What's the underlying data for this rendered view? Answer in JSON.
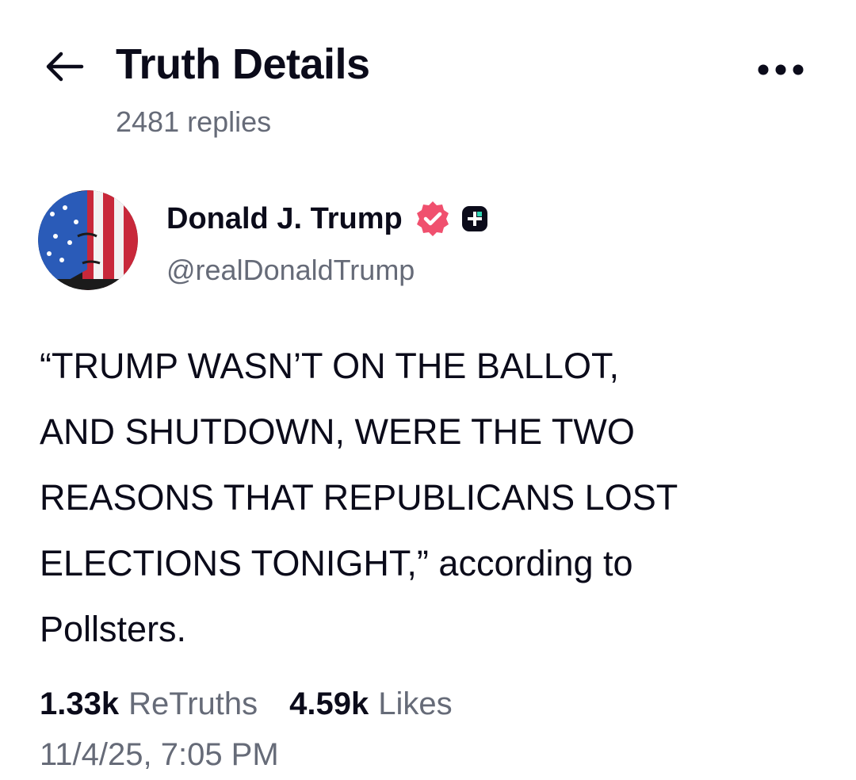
{
  "header": {
    "title": "Truth Details",
    "replies": "2481 replies",
    "back_icon": "arrow-left-icon",
    "more_icon": "more-horizontal-icon"
  },
  "author": {
    "display_name": "Donald J. Trump",
    "handle": "@realDonaldTrump",
    "verified_icon": "verified-badge-icon",
    "plus_icon": "plus-badge-icon",
    "verified_color": "#f0506e"
  },
  "post": {
    "text": "“TRUMP WASN’T ON THE BALLOT,\nAND SHUTDOWN, WERE THE TWO\nREASONS THAT REPUBLICANS LOST\nELECTIONS TONIGHT,” according to\nPollsters.",
    "retruths_count": "1.33k",
    "retruths_label": "ReTruths",
    "likes_count": "4.59k",
    "likes_label": "Likes",
    "timestamp": "11/4/25, 7:05 PM"
  },
  "colors": {
    "primary_text": "#0b0b1a",
    "secondary_text": "#666b78",
    "background": "#ffffff"
  }
}
